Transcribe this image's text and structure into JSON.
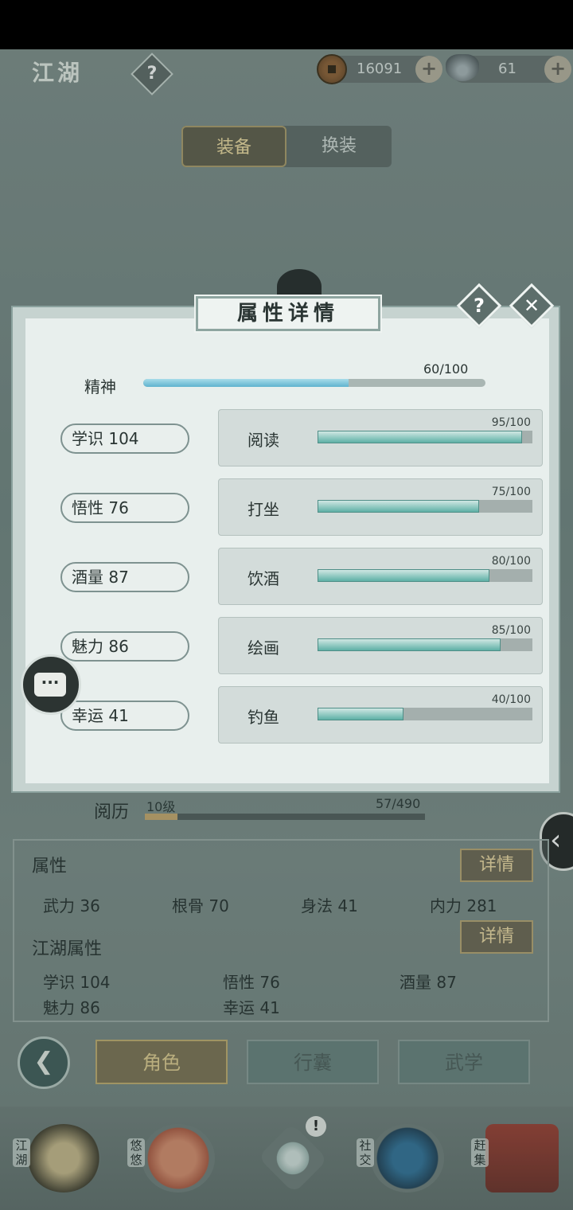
{
  "header": {
    "title": "江湖",
    "help_label": "?",
    "coins": "16091",
    "ingots": "61",
    "plus": "+"
  },
  "tabs": [
    "装备",
    "换装"
  ],
  "modal": {
    "title": "属性详情",
    "help_label": "?",
    "close_label": "✕",
    "spirit": {
      "label": "精神",
      "value": "60/100",
      "fraction": 0.6
    },
    "attributes": [
      {
        "pill": "学识 104",
        "activity": "阅读",
        "progress": "95/100",
        "fraction": 0.95
      },
      {
        "pill": "悟性 76",
        "activity": "打坐",
        "progress": "75/100",
        "fraction": 0.75
      },
      {
        "pill": "酒量 87",
        "activity": "饮酒",
        "progress": "80/100",
        "fraction": 0.8
      },
      {
        "pill": "魅力 86",
        "activity": "绘画",
        "progress": "85/100",
        "fraction": 0.85
      },
      {
        "pill": "幸运 41",
        "activity": "钓鱼",
        "progress": "40/100",
        "fraction": 0.4
      }
    ]
  },
  "experience": {
    "label": "阅历",
    "level": "10级",
    "value": "57/490",
    "fraction": 0.116
  },
  "attributes_panel": {
    "title": "属性",
    "detail_label": "详情",
    "stats": [
      "武力 36",
      "根骨 70",
      "身法 41",
      "内力 281"
    ],
    "jianghu_title": "江湖属性",
    "jianghu_detail_label": "详情",
    "jianghu_stats": [
      "学识 104",
      "悟性 76",
      "酒量 87",
      "魅力 86",
      "幸运 41"
    ]
  },
  "nav_buttons": [
    "角色",
    "行囊",
    "武学"
  ],
  "bottom_nav": {
    "items": [
      {
        "label": "江湖",
        "icon": "straw-hat-icon"
      },
      {
        "label": "悠悠",
        "icon": "swallow-icon"
      },
      {
        "label": "",
        "icon": "compass-star-icon"
      },
      {
        "label": "社交",
        "icon": "wave-icon"
      },
      {
        "label": "赶集",
        "icon": "basket-icon"
      }
    ],
    "badge": "!"
  },
  "colors": {
    "accent_gold": "#c2ad6d",
    "bar_teal": "#5eb0a6",
    "spirit_blue": "#5fb3cf"
  }
}
